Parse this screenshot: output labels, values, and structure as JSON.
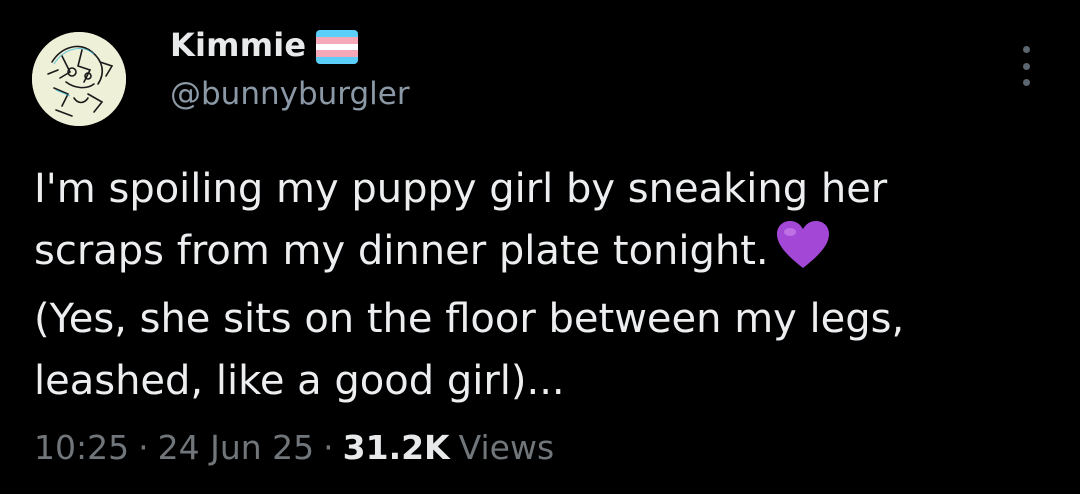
{
  "author": {
    "display_name": "Kimmie",
    "handle": "@bunnyburgler",
    "badge_icon": "transgender-flag-icon",
    "avatar_icon": "cartoon-sketch-avatar-icon"
  },
  "menu_icon": "more-vertical-icon",
  "tweet": {
    "line1": "I'm spoiling my puppy girl by sneaking her",
    "line2": "scraps from my dinner plate tonight.",
    "line2_emoji": "purple-heart-icon",
    "line3": "(Yes, she sits on the floor between my legs,",
    "line4": "leashed, like a good girl)..."
  },
  "meta": {
    "time": "10:25",
    "separator": "·",
    "date": "24 Jun 25",
    "views_count": "31.2K",
    "views_label": "Views"
  },
  "colors": {
    "background": "#000000",
    "text": "#e7e9ea",
    "secondary": "#8b98a5",
    "heart": "#a247d6",
    "flag_blue": "#5bcefa",
    "flag_pink": "#f5a9b8",
    "flag_white": "#ffffff"
  }
}
